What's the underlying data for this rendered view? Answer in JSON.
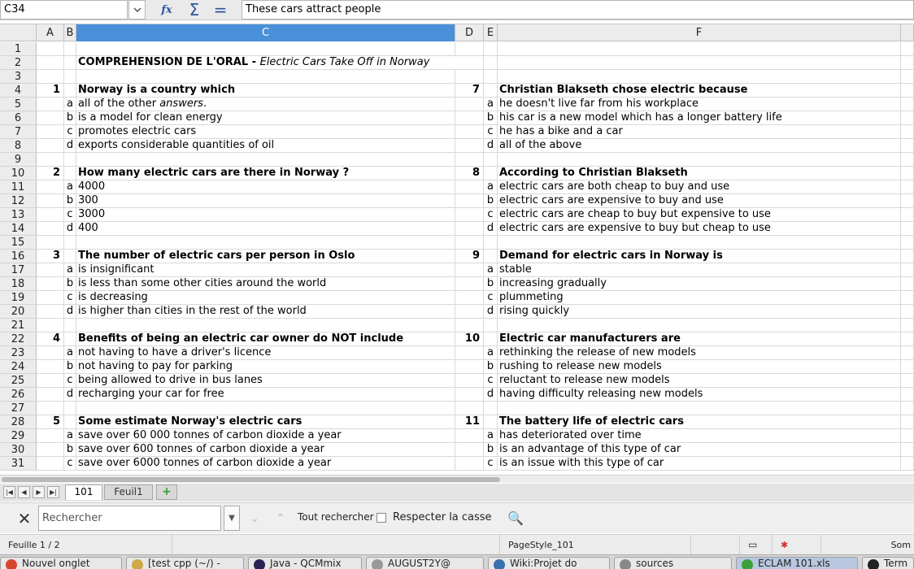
{
  "formula": {
    "cell_ref": "C34",
    "content": "These cars attract people"
  },
  "columns": [
    "A",
    "B",
    "C",
    "D",
    "E",
    "F"
  ],
  "rows": [
    {
      "n": "1"
    },
    {
      "n": "2",
      "title_bold": "COMPREHENSION DE L'ORAL - ",
      "title_italic": "Electric Cars Take Off in Norway"
    },
    {
      "n": "3"
    },
    {
      "n": "4",
      "a": "1",
      "c": "Norway is a country which",
      "d": "7",
      "f": "Christian Blakseth chose electric because",
      "qrow": true
    },
    {
      "n": "5",
      "b": "a",
      "c": "all of the other ",
      "c_it": "answers",
      "c_tail": ".",
      "e": "a",
      "f": "he doesn't live far from his workplace"
    },
    {
      "n": "6",
      "b": "b",
      "c": "is a model for clean energy",
      "e": "b",
      "f": "his car is a new model which has a longer battery life"
    },
    {
      "n": "7",
      "b": "c",
      "c": "promotes electric cars",
      "e": "c",
      "f": "he has a bike and a car"
    },
    {
      "n": "8",
      "b": "d",
      "c": "exports considerable quantities of oil",
      "e": "d",
      "f": "all of the above"
    },
    {
      "n": "9"
    },
    {
      "n": "10",
      "a": "2",
      "c": "How many electric cars are there in Norway ?",
      "d": "8",
      "f": "According to Christian Blakseth",
      "qrow": true
    },
    {
      "n": "11",
      "b": "a",
      "c": "4000",
      "e": "a",
      "f": "electric cars are both cheap to buy and use"
    },
    {
      "n": "12",
      "b": "b",
      "c": "300",
      "e": "b",
      "f": "electric cars are expensive to buy and use"
    },
    {
      "n": "13",
      "b": "c",
      "c": "3000",
      "e": "c",
      "f": "electric cars are cheap to buy but expensive to use"
    },
    {
      "n": "14",
      "b": "d",
      "c": "400",
      "e": "d",
      "f": "electric cars are expensive to buy but cheap to use"
    },
    {
      "n": "15"
    },
    {
      "n": "16",
      "a": "3",
      "c": "The number of electric cars per person in Oslo",
      "d": "9",
      "f": "Demand for electric cars in Norway is",
      "qrow": true
    },
    {
      "n": "17",
      "b": "a",
      "c": "is insignificant",
      "e": "a",
      "f": "stable"
    },
    {
      "n": "18",
      "b": "b",
      "c": "is less than some other cities around the world",
      "e": "b",
      "f": "increasing gradually"
    },
    {
      "n": "19",
      "b": "c",
      "c": "is decreasing",
      "e": "c",
      "f": "plummeting"
    },
    {
      "n": "20",
      "b": "d",
      "c": "is higher than cities in the rest of the world",
      "e": "d",
      "f": "rising quickly"
    },
    {
      "n": "21"
    },
    {
      "n": "22",
      "a": "4",
      "c": "Benefits of being an electric car owner do NOT include",
      "d": "10",
      "f": "Electric car manufacturers are",
      "qrow": true
    },
    {
      "n": "23",
      "b": "a",
      "c": "not having to have a driver's licence",
      "e": "a",
      "f": "rethinking the release of new models"
    },
    {
      "n": "24",
      "b": "b",
      "c": "not having to pay for parking",
      "e": "b",
      "f": "rushing to release new models"
    },
    {
      "n": "25",
      "b": "c",
      "c": "being allowed to drive in bus lanes",
      "e": "c",
      "f": "reluctant to release new models"
    },
    {
      "n": "26",
      "b": "d",
      "c": "recharging your car for free",
      "e": "d",
      "f": "having difficulty releasing new models"
    },
    {
      "n": "27"
    },
    {
      "n": "28",
      "a": "5",
      "c": "Some estimate Norway's electric cars",
      "d": "11",
      "f": "The battery life of electric cars",
      "qrow": true
    },
    {
      "n": "29",
      "b": "a",
      "c": "save over 60 000 tonnes of carbon dioxide a year",
      "e": "a",
      "f": "has deteriorated over time"
    },
    {
      "n": "30",
      "b": "b",
      "c": "save over 600 tonnes of carbon dioxide a year",
      "e": "b",
      "f": "is an advantage of this type of car"
    },
    {
      "n": "31",
      "b": "c",
      "c": "save over 6000 tonnes of carbon dioxide a year",
      "e": "c",
      "f": "is an issue with this type of car"
    }
  ],
  "sheet_tabs": [
    {
      "label": "101",
      "active": true
    },
    {
      "label": "Feuil1",
      "active": false
    }
  ],
  "find": {
    "placeholder": "Rechercher",
    "find_all": "Tout rechercher",
    "match_case": "Respecter la casse"
  },
  "status": {
    "sheet": "Feuille 1 / 2",
    "page_style": "PageStyle_101",
    "sum": "Som"
  },
  "taskbar": [
    {
      "label": "Nouvel onglet",
      "icon": "chrome-icon",
      "color": "#d9442f"
    },
    {
      "label": "[test cpp (~/) -",
      "icon": "editor-icon",
      "color": "#cfa84a"
    },
    {
      "label": "Java - QCMmix",
      "icon": "eclipse-icon",
      "color": "#2c2255"
    },
    {
      "label": "AUGUST2Y@",
      "icon": "window-icon",
      "color": "#999999"
    },
    {
      "label": "Wiki:Projet do",
      "icon": "browser-icon",
      "color": "#3a6fb0"
    },
    {
      "label": "sources",
      "icon": "folder-icon",
      "color": "#888888"
    },
    {
      "label": "ECLAM 101.xls",
      "icon": "calc-icon",
      "color": "#3aa03a",
      "active": true
    },
    {
      "label": "Term",
      "icon": "terminal-icon",
      "color": "#222222"
    }
  ],
  "colors": {
    "selected_header": "#4a90d9",
    "accent": "#2f55a0"
  }
}
